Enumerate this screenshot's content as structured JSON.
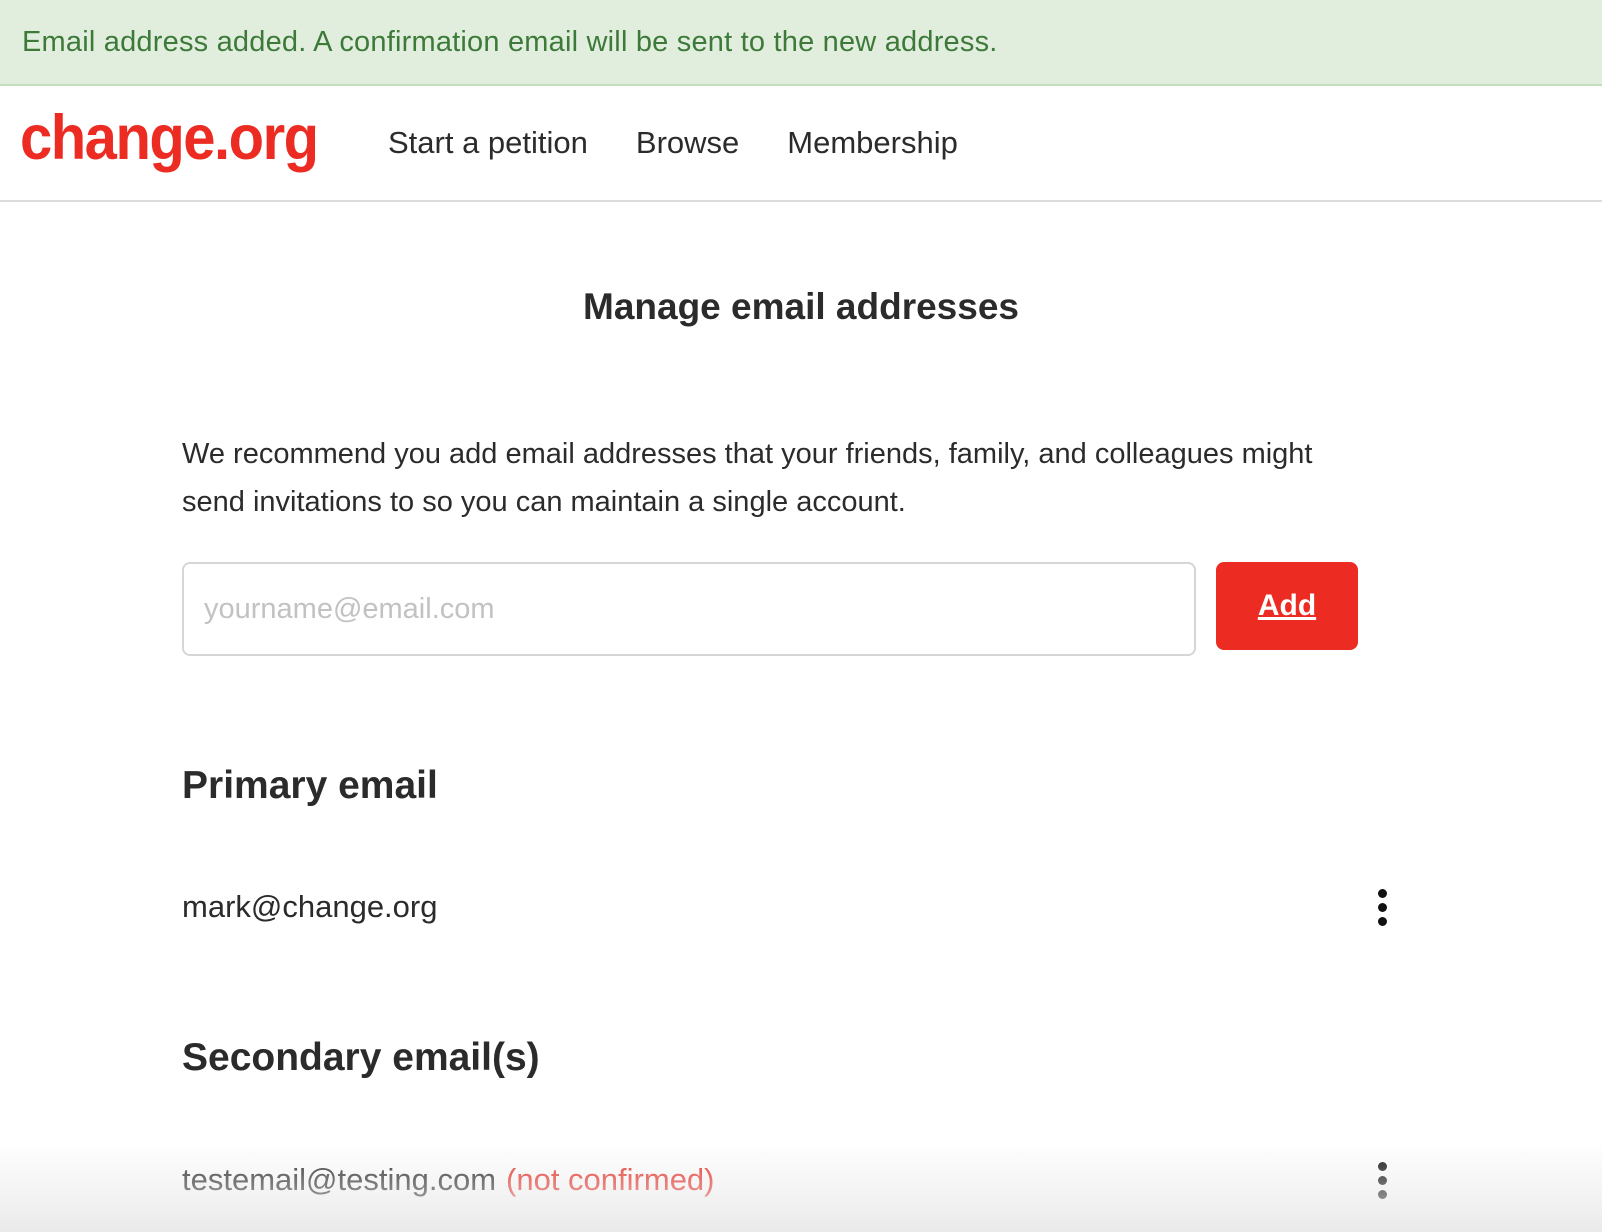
{
  "banner": {
    "message": "Email address added. A confirmation email will be sent to the new address."
  },
  "header": {
    "logo": "change.org",
    "nav": [
      {
        "label": "Start a petition"
      },
      {
        "label": "Browse"
      },
      {
        "label": "Membership"
      }
    ]
  },
  "main": {
    "title": "Manage email addresses",
    "intro": "We recommend you add email addresses that your friends, family, and colleagues might send invitations to so you can maintain a single account.",
    "add_form": {
      "placeholder": "yourname@email.com",
      "value": "",
      "button_label": "Add"
    },
    "primary": {
      "heading": "Primary email",
      "email": "mark@change.org",
      "menu_icon": "more-vertical-icon"
    },
    "secondary": {
      "heading": "Secondary email(s)",
      "items": [
        {
          "email": "testemail@testing.com",
          "status": "(not confirmed)",
          "menu_icon": "more-vertical-icon"
        }
      ]
    }
  },
  "colors": {
    "brand": "#ec2c22",
    "banner_bg": "#e1eedd",
    "banner_text": "#3d7a3a",
    "status_warning": "#e8322a"
  }
}
